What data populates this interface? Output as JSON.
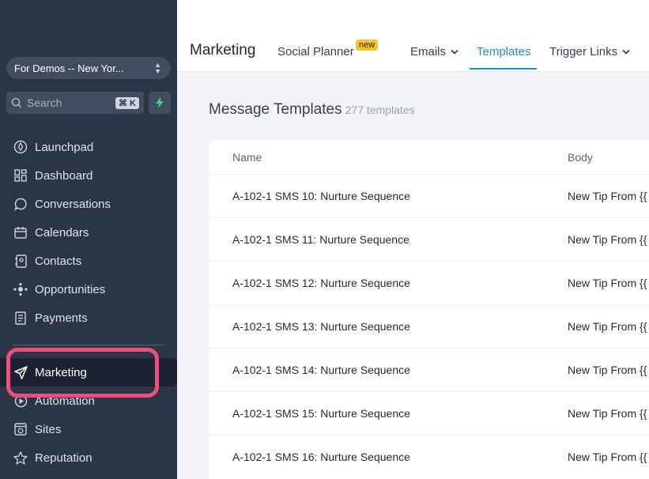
{
  "sidebar": {
    "account": "For Demos -- New Yor...",
    "search_placeholder": "Search",
    "search_shortcut": "⌘ K",
    "items": [
      {
        "label": "Launchpad",
        "icon": "rocket-icon"
      },
      {
        "label": "Dashboard",
        "icon": "grid-icon"
      },
      {
        "label": "Conversations",
        "icon": "chat-icon"
      },
      {
        "label": "Calendars",
        "icon": "calendar-icon"
      },
      {
        "label": "Contacts",
        "icon": "contacts-icon"
      },
      {
        "label": "Opportunities",
        "icon": "opportunities-icon"
      },
      {
        "label": "Payments",
        "icon": "payments-icon"
      },
      {
        "label": "Marketing",
        "icon": "send-icon",
        "active": true
      },
      {
        "label": "Automation",
        "icon": "automation-icon"
      },
      {
        "label": "Sites",
        "icon": "sites-icon"
      },
      {
        "label": "Reputation",
        "icon": "star-icon"
      }
    ]
  },
  "header": {
    "title": "Marketing",
    "tabs": [
      {
        "label": "Social Planner",
        "badge": "new"
      },
      {
        "label": "Emails"
      },
      {
        "label": "Templates",
        "active": true
      },
      {
        "label": "Trigger Links"
      }
    ]
  },
  "main": {
    "heading": "Message Templates",
    "count": "277 templates",
    "columns": [
      "Name",
      "Body"
    ],
    "rows": [
      {
        "name": "A-102-1 SMS 10: Nurture Sequence",
        "body": "New Tip From {{"
      },
      {
        "name": "A-102-1 SMS 11: Nurture Sequence",
        "body": "New Tip From {{"
      },
      {
        "name": "A-102-1 SMS 12: Nurture Sequence",
        "body": "New Tip From {{"
      },
      {
        "name": "A-102-1 SMS 13: Nurture Sequence",
        "body": "New Tip From {{"
      },
      {
        "name": "A-102-1 SMS 14: Nurture Sequence",
        "body": "New Tip From {{"
      },
      {
        "name": "A-102-1 SMS 15: Nurture Sequence",
        "body": "New Tip From {{"
      },
      {
        "name": "A-102-1 SMS 16: Nurture Sequence",
        "body": "New Tip From {{"
      }
    ]
  },
  "colors": {
    "sidebar_bg": "#2b3548",
    "accent": "#1e8fc8",
    "highlight": "#ec4f7c",
    "badge": "#f4c430"
  }
}
